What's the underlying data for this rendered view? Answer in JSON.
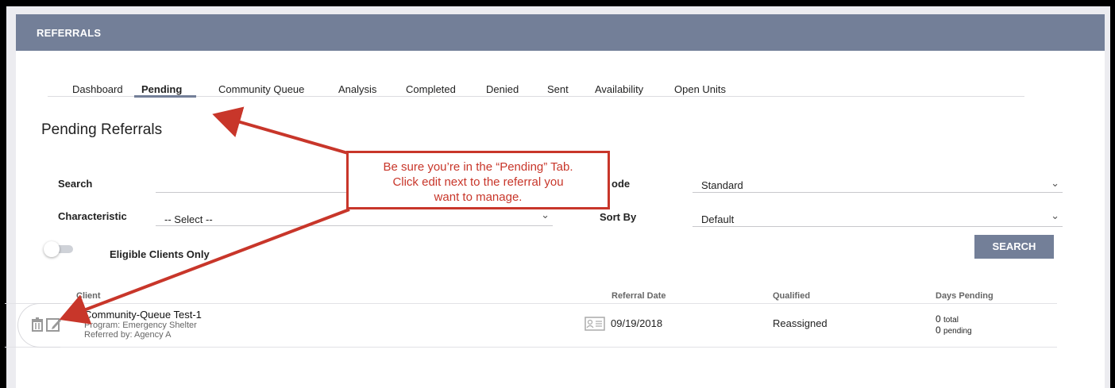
{
  "header": {
    "title": "REFERRALS"
  },
  "tabs": [
    {
      "label": "Dashboard"
    },
    {
      "label": "Pending",
      "active": true
    },
    {
      "label": "Community Queue"
    },
    {
      "label": "Analysis"
    },
    {
      "label": "Completed"
    },
    {
      "label": "Denied"
    },
    {
      "label": "Sent"
    },
    {
      "label": "Availability"
    },
    {
      "label": "Open Units"
    }
  ],
  "page_title": "Pending Referrals",
  "filters": {
    "search_label": "Search",
    "mode_label": "ode",
    "mode_value": "Standard",
    "characteristic_label": "Characteristic",
    "characteristic_value": "-- Select --",
    "sort_label": "Sort By",
    "sort_value": "Default",
    "eligible_label": "Eligible Clients Only",
    "eligible_on": false,
    "search_button": "SEARCH"
  },
  "table": {
    "columns": [
      "Client",
      "Referral Date",
      "Qualified",
      "Days Pending"
    ],
    "rows": [
      {
        "client": "Community-Queue Test-1",
        "program": "Program: Emergency Shelter",
        "referred_by": "Referred by: Agency A",
        "referral_date": "09/19/2018",
        "qualified": "Reassigned",
        "days_total_num": "0",
        "days_total_unit": "total",
        "days_pending_num": "0",
        "days_pending_unit": "pending"
      }
    ]
  },
  "callout": {
    "line1": "Be sure you’re in the “Pending” Tab.",
    "line2": "Click edit next to the referral you",
    "line3": "want to manage."
  },
  "icons": {
    "delete": "trash-icon",
    "edit": "edit-icon",
    "contact": "contact-card-icon",
    "chevron": "chevron-down-icon"
  },
  "colors": {
    "header": "#737f98",
    "annotation": "#c8362a",
    "button": "#737f98"
  }
}
